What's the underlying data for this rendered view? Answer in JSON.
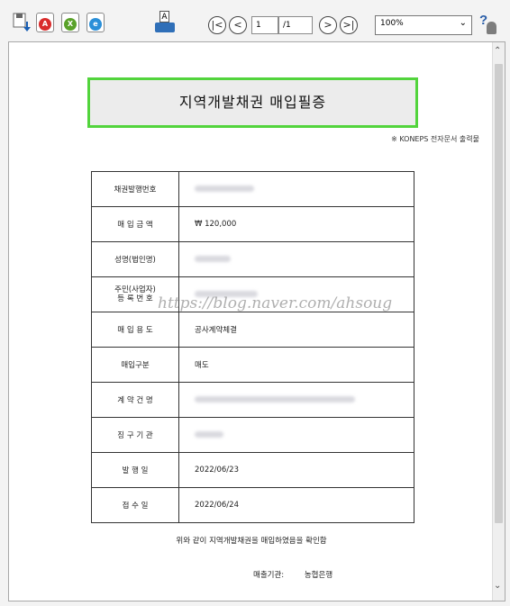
{
  "toolbar": {
    "save_icon": "save-down-icon",
    "pdf_badge": "A",
    "excel_badge": "X",
    "hwp_badge": "e",
    "print_text": "A",
    "first_label": "|<",
    "prev_label": "<",
    "page_current": "1",
    "page_total": "/1",
    "next_label": ">",
    "last_label": ">|",
    "zoom": "100%",
    "help_label": "?",
    "accent": "#52d43c"
  },
  "document": {
    "title": "지역개발채권 매입필증",
    "koneps_note": "※ KONEPS 전자문서 출력물",
    "rows": [
      {
        "label": "채권발행번호",
        "value": ""
      },
      {
        "label": "매 입 금 액",
        "value": "₩ 120,000"
      },
      {
        "label": "성명(법인명)",
        "value": ""
      },
      {
        "label": "주민(사업자)\n등 록 번 호",
        "value": ""
      },
      {
        "label": "매 입 용 도",
        "value": "공사계약체결"
      },
      {
        "label": "매입구분",
        "value": "매도"
      },
      {
        "label": "계 약 건 명",
        "value": ""
      },
      {
        "label": "징 구 기 관",
        "value": ""
      },
      {
        "label": "발 행 일",
        "value": "2022/06/23"
      },
      {
        "label": "접 수 일",
        "value": "2022/06/24"
      }
    ],
    "confirm_text": "위와 같이 지역개발채권을 매입하였음을 확인함",
    "issuer_label": "매출기관:",
    "issuer_value": "농협은행"
  },
  "watermark": "https://blog.naver.com/ahsoug"
}
